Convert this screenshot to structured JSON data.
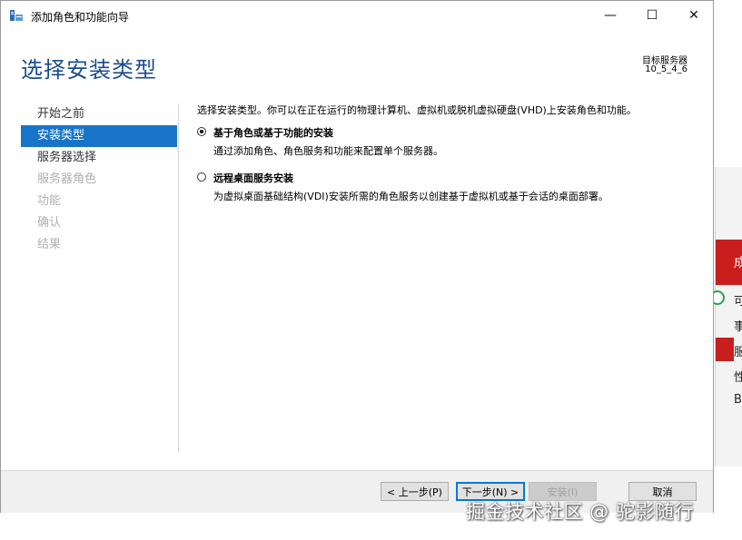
{
  "window": {
    "title": "添加角色和功能向导",
    "min_symbol": "—",
    "max_symbol": "☐",
    "close_symbol": "✕"
  },
  "header": {
    "page_title": "选择安装类型",
    "target_label": "目标服务器",
    "target_value": "10_5_4_6"
  },
  "nav": {
    "items": [
      {
        "label": "开始之前",
        "state": "normal"
      },
      {
        "label": "安装类型",
        "state": "active"
      },
      {
        "label": "服务器选择",
        "state": "normal"
      },
      {
        "label": "服务器角色",
        "state": "disabled"
      },
      {
        "label": "功能",
        "state": "disabled"
      },
      {
        "label": "确认",
        "state": "disabled"
      },
      {
        "label": "结果",
        "state": "disabled"
      }
    ]
  },
  "content": {
    "intro": "选择安装类型。你可以在正在运行的物理计算机、虚拟机或脱机虚拟硬盘(VHD)上安装角色和功能。",
    "options": [
      {
        "title": "基于角色或基于功能的安装",
        "desc": "通过添加角色、角色服务和功能来配置单个服务器。",
        "checked": true
      },
      {
        "title": "远程桌面服务安装",
        "desc": "为虚拟桌面基础结构(VDI)安装所需的角色服务以创建基于虚拟机或基于会话的桌面部署。",
        "checked": false
      }
    ]
  },
  "footer": {
    "prev_label": "< 上一步(P)",
    "next_label": "下一步(N) >",
    "install_label": "安装(I)",
    "cancel_label": "取消"
  },
  "background": {
    "header_char": "成",
    "rows": [
      "可",
      "事",
      "服",
      "性",
      "B"
    ]
  },
  "watermark": "掘金技术社区 @ 驼影随行",
  "colors": {
    "title_blue": "#1a4d8c",
    "nav_active": "#1874c8",
    "bg_accent": "#c81e1e"
  }
}
